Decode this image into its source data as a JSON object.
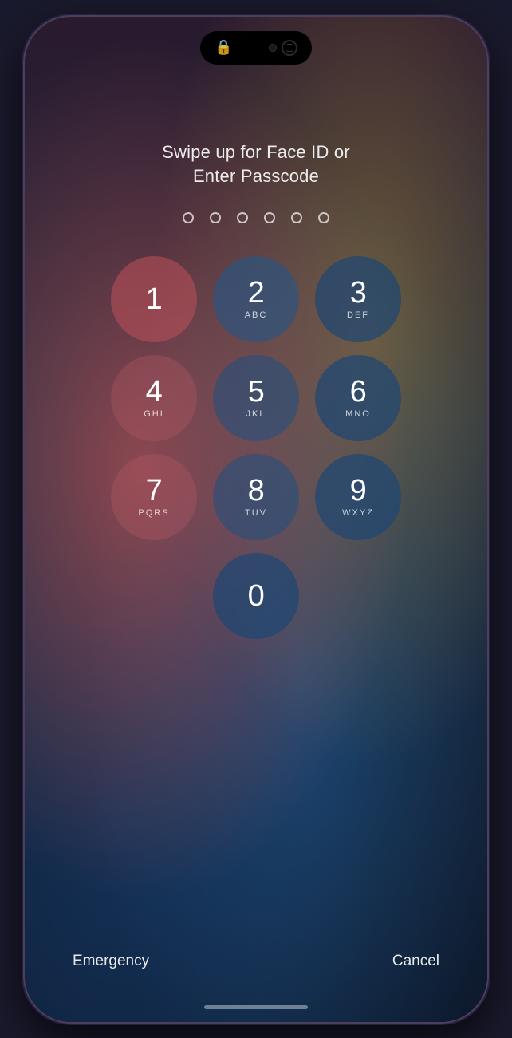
{
  "phone": {
    "swipe_text": "Swipe up for Face ID or\nEnter Passcode",
    "dots_count": 6,
    "numpad": {
      "rows": [
        [
          {
            "number": "1",
            "letters": "",
            "style": "style-red"
          },
          {
            "number": "2",
            "letters": "ABC",
            "style": "style-blue-dark"
          },
          {
            "number": "3",
            "letters": "DEF",
            "style": "style-blue-deep"
          }
        ],
        [
          {
            "number": "4",
            "letters": "GHI",
            "style": "style-muted-red"
          },
          {
            "number": "5",
            "letters": "JKL",
            "style": "style-blue-mid"
          },
          {
            "number": "6",
            "letters": "MNO",
            "style": "style-blue-deep"
          }
        ],
        [
          {
            "number": "7",
            "letters": "PQRS",
            "style": "style-muted-red"
          },
          {
            "number": "8",
            "letters": "TUV",
            "style": "style-blue-mid"
          },
          {
            "number": "9",
            "letters": "WXYZ",
            "style": "style-blue-deep"
          }
        ]
      ],
      "zero": {
        "number": "0",
        "letters": "",
        "style": "style-blue-deep"
      }
    },
    "emergency_label": "Emergency",
    "cancel_label": "Cancel"
  }
}
